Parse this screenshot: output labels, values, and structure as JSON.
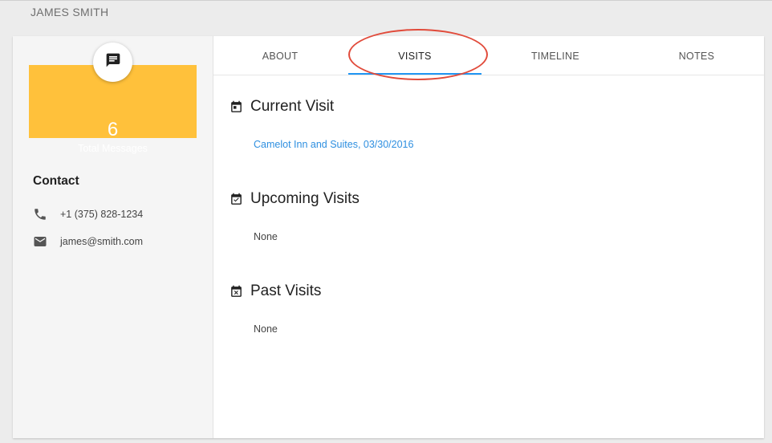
{
  "header": {
    "title": "JAMES SMITH"
  },
  "sidebar": {
    "messages": {
      "count": "6",
      "label": "Total Messages",
      "icon": "message-icon",
      "accent": "#ffc13b"
    },
    "contact": {
      "heading": "Contact",
      "phone": {
        "icon": "phone-icon",
        "value": "+1 (375) 828-1234"
      },
      "email": {
        "icon": "email-icon",
        "value": "james@smith.com"
      }
    }
  },
  "tabs": [
    {
      "label": "ABOUT"
    },
    {
      "label": "VISITS",
      "active": true
    },
    {
      "label": "TIMELINE"
    },
    {
      "label": "NOTES"
    }
  ],
  "sections": {
    "current": {
      "title": "Current Visit",
      "icon": "calendar-today-icon",
      "value": "Camelot Inn and Suites, 03/30/2016"
    },
    "upcoming": {
      "title": "Upcoming Visits",
      "icon": "calendar-check-icon",
      "value": "None"
    },
    "past": {
      "title": "Past Visits",
      "icon": "calendar-remove-icon",
      "value": "None"
    }
  },
  "colors": {
    "link": "#2e8fe0",
    "tab_indicator": "#2196f3",
    "annotation": "#e14b3b"
  }
}
